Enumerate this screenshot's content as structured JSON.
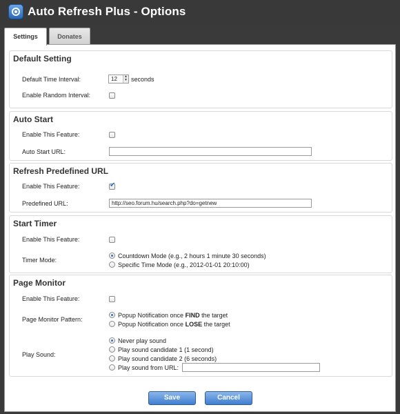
{
  "app": {
    "title": "Auto Refresh Plus - Options",
    "icon": "refresh-target-icon"
  },
  "tabs": [
    {
      "label": "Settings",
      "active": true
    },
    {
      "label": "Donates",
      "active": false
    }
  ],
  "default_setting": {
    "title": "Default Setting",
    "time_interval_label": "Default Time Interval:",
    "time_interval_value": "12",
    "time_interval_unit": "seconds",
    "random_interval_label": "Enable Random Interval:",
    "random_interval_checked": false
  },
  "auto_start": {
    "title": "Auto Start",
    "enable_label": "Enable This Feature:",
    "enable_checked": false,
    "url_label": "Auto Start URL:",
    "url_value": ""
  },
  "refresh_predefined": {
    "title": "Refresh Predefined URL",
    "enable_label": "Enable This Feature:",
    "enable_checked": true,
    "url_label": "Predefined URL:",
    "url_value": "http://seo.forum.hu/search.php?do=getnew"
  },
  "start_timer": {
    "title": "Start Timer",
    "enable_label": "Enable This Feature:",
    "enable_checked": false,
    "mode_label": "Timer Mode:",
    "options": [
      {
        "label": "Countdown Mode (e.g., 2 hours 1 minute 30 seconds)",
        "selected": true
      },
      {
        "label": "Specific Time Mode (e.g., 2012-01-01 20:10:00)",
        "selected": false
      }
    ]
  },
  "page_monitor": {
    "title": "Page Monitor",
    "enable_label": "Enable This Feature:",
    "enable_checked": false,
    "pattern_label": "Page Monitor Pattern:",
    "pattern_options": [
      {
        "prefix": "Popup Notification once ",
        "bold": "FIND",
        "suffix": " the target",
        "selected": true
      },
      {
        "prefix": "Popup Notification once ",
        "bold": "LOSE",
        "suffix": " the target",
        "selected": false
      }
    ],
    "sound_label": "Play Sound:",
    "sound_options": [
      {
        "label": "Never play sound",
        "selected": true
      },
      {
        "label": "Play sound candidate 1 (1 second)",
        "selected": false
      },
      {
        "label": "Play sound candidate 2 (6 seconds)",
        "selected": false
      },
      {
        "label": "Play sound from URL:",
        "selected": false
      }
    ],
    "sound_url_value": ""
  },
  "buttons": {
    "save": "Save",
    "cancel": "Cancel"
  }
}
